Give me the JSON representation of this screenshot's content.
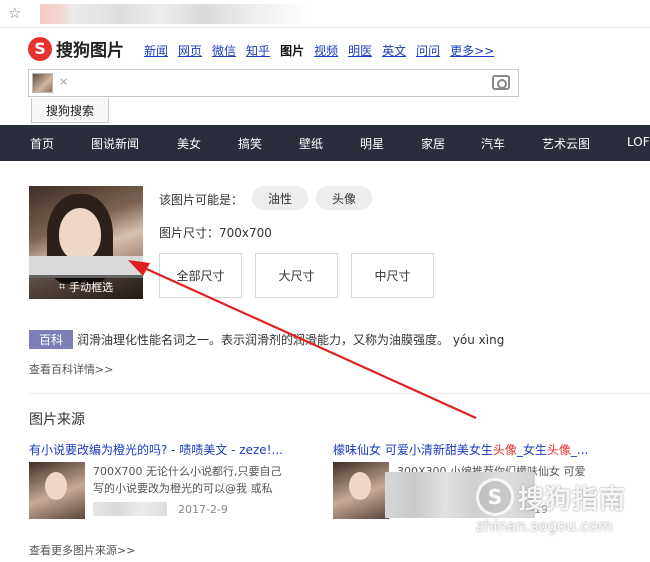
{
  "header": {
    "logo_letter": "S",
    "logo_text": "搜狗图片",
    "nav": [
      {
        "label": "新闻"
      },
      {
        "label": "网页"
      },
      {
        "label": "微信"
      },
      {
        "label": "知乎"
      },
      {
        "label": "图片",
        "active": true
      },
      {
        "label": "视频"
      },
      {
        "label": "明医"
      },
      {
        "label": "英文"
      },
      {
        "label": "问问"
      },
      {
        "label": "更多>>"
      }
    ]
  },
  "search": {
    "close_glyph": "×",
    "button_label": "搜狗搜索"
  },
  "categories": [
    "首页",
    "图说新闻",
    "美女",
    "搞笑",
    "壁纸",
    "明星",
    "家居",
    "汽车",
    "艺术云图",
    "LOF"
  ],
  "image_info": {
    "crop_label": "手动框选",
    "guess_label": "该图片可能是：",
    "tags": [
      "油性",
      "头像"
    ],
    "size_label": "图片尺寸：700x700",
    "size_buttons": [
      "全部尺寸",
      "大尺寸",
      "中尺寸"
    ]
  },
  "baike": {
    "badge": "百科",
    "text": "润滑油理化性能名词之一。表示润滑剂的润滑能力，又称为油膜强度。 yóu xìng",
    "more": "查看百科详情>>"
  },
  "sources": {
    "title": "图片来源",
    "items": [
      {
        "title": "有小说要改编为橙光的吗? - 啧啧美文 - zeze!...",
        "desc_line1": "700X700 无论什么小说都行,只要自己",
        "desc_line2": "写的小说要改为橙光的可以@我 或私",
        "date": "2017-2-9"
      },
      {
        "title_prefix": "檬味仙女 可爱小清新甜美女生",
        "title_hl1": "头像",
        "title_mid": "_女生",
        "title_hl2": "头像",
        "title_suffix": "_...",
        "desc_line1": "300X300 小编推荐你们檬味仙女 可爱",
        "desc_line2": "小清新甜美女生头像 女生头",
        "date": "-19"
      }
    ],
    "more": "查看更多图片来源>>"
  },
  "watermark": {
    "letter": "S",
    "text": "搜狗指南",
    "url": "zhinan.sogou.com"
  },
  "colors": {
    "brand_red": "#e5322d",
    "link_blue": "#1a3bbf",
    "nav_bg": "#2a2d3b",
    "baike_badge": "#7d7fb4",
    "arrow_red": "#e02020"
  }
}
